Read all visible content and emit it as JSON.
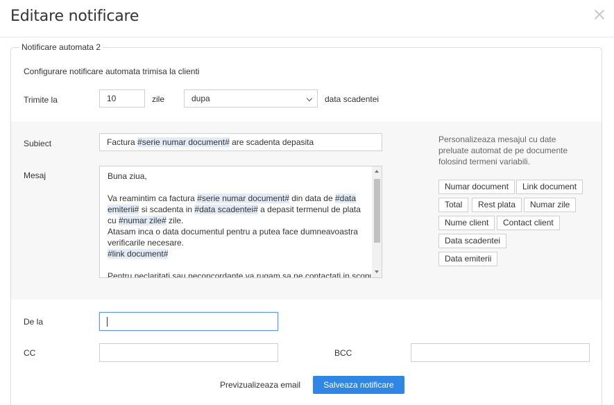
{
  "modal": {
    "title": "Editare notificare"
  },
  "section": {
    "legend": "Notificare automata 2",
    "description": "Configurare notificare automata trimisa la clienti"
  },
  "schedule": {
    "label": "Trimite la",
    "days_value": "10",
    "days_unit": "zile",
    "relation_value": "dupa",
    "suffix": "data scadentei"
  },
  "subject": {
    "label": "Subiect",
    "prefix": "Factura ",
    "tag": "#serie numar document#",
    "suffix": " are scadenta depasita"
  },
  "message": {
    "label": "Mesaj",
    "greeting": "Buna ziua,",
    "p1_a": "Va reamintim ca factura ",
    "p1_tag1": "#serie numar document#",
    "p1_b": " din data de ",
    "p1_tag2": "#data emiterii#",
    "p1_c": " si scadenta in ",
    "p1_tag3": "#data scadentei#",
    "p1_d": " a depasit termenul de plata cu ",
    "p1_tag4": "#numar zile#",
    "p1_e": " zile.",
    "p2": "Atasam inca o data documentul pentru a putea face dumneavoastra verificarile necesare.",
    "p2_tag": "#link document#",
    "p3": "Pentru neclaritati sau neconcordante va rugam sa ne contactati in scopul"
  },
  "hint": "Personalizeaza mesajul cu date preluate automat de pe documente folosind termeni variabili.",
  "variables": [
    "Numar document",
    "Link document",
    "Total",
    "Rest plata",
    "Numar zile",
    "Nume client",
    "Contact client",
    "Data scadentei",
    "Data emiterii"
  ],
  "from": {
    "label": "De la",
    "value": ""
  },
  "cc": {
    "label": "CC",
    "value": ""
  },
  "bcc": {
    "label": "BCC",
    "value": ""
  },
  "actions": {
    "preview": "Previzualizeaza email",
    "save": "Salveaza notificare"
  },
  "colors": {
    "primary": "#2f86e4",
    "tag_highlight": "#e3ebf6",
    "band": "#f7f7f7"
  }
}
